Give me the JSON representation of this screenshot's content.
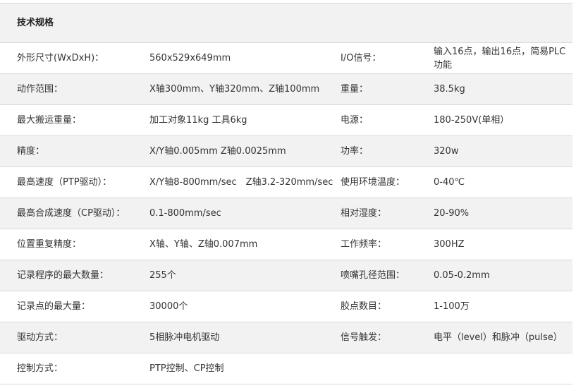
{
  "title": "技术规格",
  "rows": [
    {
      "label1": "外形尺寸(WxDxH)：",
      "value1": "560x529x649mm",
      "label2": "I/O信号：",
      "value2": "输入16点，输出16点，简易PLC功能"
    },
    {
      "label1": "动作范围：",
      "value1": "X轴300mm、Y轴320mm、Z轴100mm",
      "label2": "重量：",
      "value2": "38.5kg"
    },
    {
      "label1": "最大搬运重量：",
      "value1": "加工对象11kg 工具6kg",
      "label2": "电源：",
      "value2": "180-250V(单相）"
    },
    {
      "label1": "精度：",
      "value1": "X/Y轴0.005mm Z轴0.0025mm",
      "label2": "功率：",
      "value2": "320w"
    },
    {
      "label1": "最高速度（PTP驱动）：",
      "value1": "X/Y轴8-800mm/sec　Z轴3.2-320mm/sec",
      "label2": "使用环境温度：",
      "value2": "0-40℃"
    },
    {
      "label1": "最高合成速度（CP驱动）：",
      "value1": "0.1-800mm/sec",
      "label2": "相对湿度：",
      "value2": "20-90%"
    },
    {
      "label1": "位置重复精度：",
      "value1": "X轴、Y轴、Z轴0.007mm",
      "label2": "工作频率：",
      "value2": "300HZ"
    },
    {
      "label1": "记录程序的最大数量：",
      "value1": "255个",
      "label2": "喷嘴孔径范围：",
      "value2": "0.05-0.2mm"
    },
    {
      "label1": "记录点的最大量：",
      "value1": "30000个",
      "label2": "胶点数目：",
      "value2": "1-100万"
    },
    {
      "label1": "驱动方式：",
      "value1": "5相脉冲电机驱动",
      "label2": "信号触发：",
      "value2": "电平（level）和脉冲（pulse）"
    },
    {
      "label1": "控制方式：",
      "value1": "PTP控制、CP控制",
      "label2": "",
      "value2": ""
    }
  ]
}
